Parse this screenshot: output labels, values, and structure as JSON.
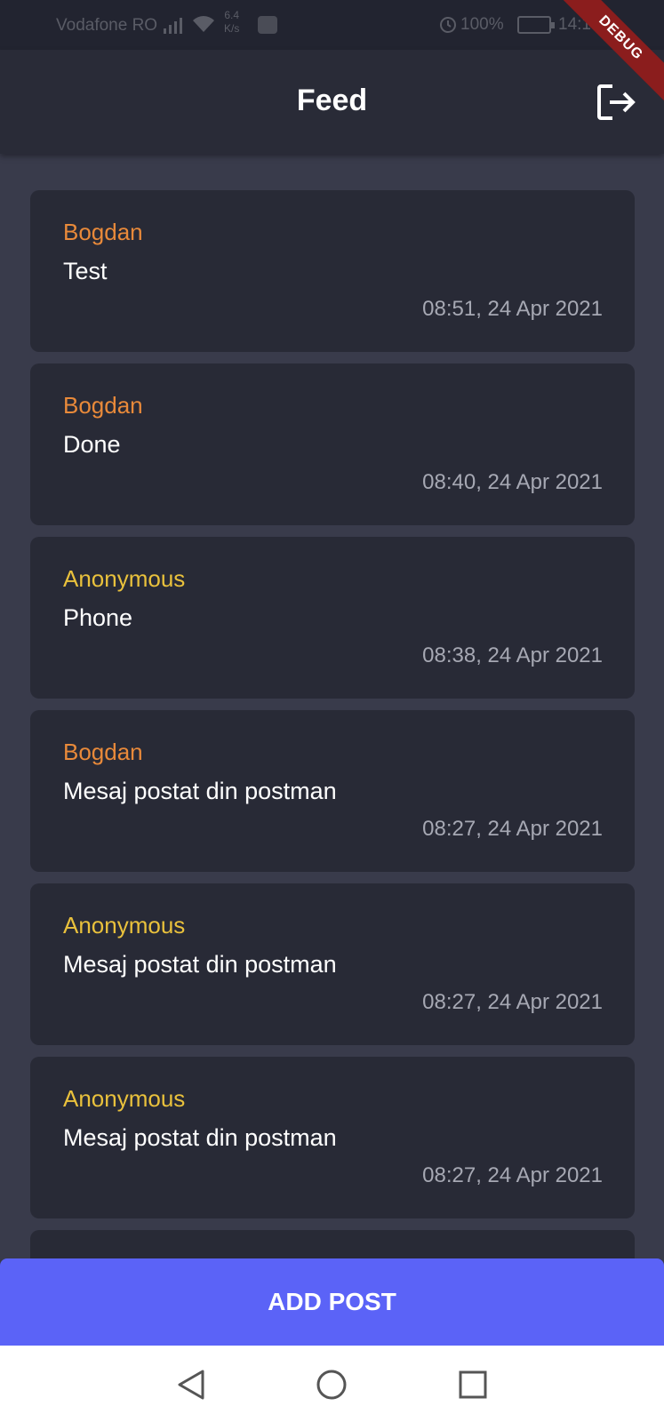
{
  "status_bar": {
    "carrier": "Vodafone RO",
    "speed_value": "6.4",
    "speed_unit": "K/s",
    "battery": "100%",
    "time": "14:1"
  },
  "debug_banner": "DEBUG",
  "app_bar": {
    "title": "Feed"
  },
  "posts": [
    {
      "author": "Bogdan",
      "message": "Test",
      "timestamp": "08:51, 24 Apr 2021"
    },
    {
      "author": "Bogdan",
      "message": "Done",
      "timestamp": "08:40, 24 Apr 2021"
    },
    {
      "author": "Anonymous",
      "message": "Phone",
      "timestamp": "08:38, 24 Apr 2021"
    },
    {
      "author": "Bogdan",
      "message": "Mesaj postat din postman",
      "timestamp": "08:27, 24 Apr 2021"
    },
    {
      "author": "Anonymous",
      "message": "Mesaj postat din postman",
      "timestamp": "08:27, 24 Apr 2021"
    },
    {
      "author": "Anonymous",
      "message": "Mesaj postat din postman",
      "timestamp": "08:27, 24 Apr 2021"
    }
  ],
  "add_post_label": "ADD POST",
  "colors": {
    "background": "#393b4b",
    "card": "#282a36",
    "app_bar": "#292b37",
    "author_user": "#e98a3a",
    "author_anonymous": "#e9c13c",
    "accent_button": "#5b63f7"
  },
  "icons": {
    "logout": "logout-icon",
    "nav_back": "back-triangle-icon",
    "nav_home": "home-circle-icon",
    "nav_recents": "recents-square-icon"
  }
}
